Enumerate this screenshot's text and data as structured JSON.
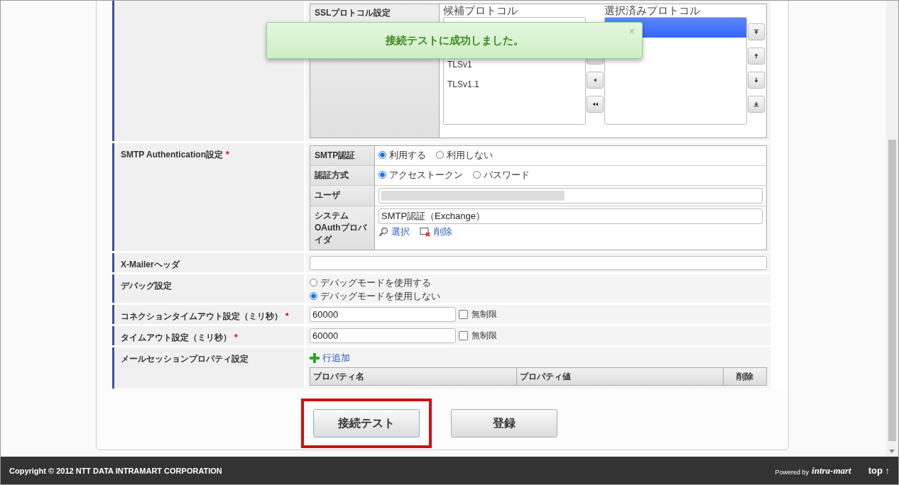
{
  "toast": {
    "message": "接続テストに成功しました。",
    "close": "×"
  },
  "ssl": {
    "label": "SSLプロトコル設定",
    "available_heading": "候補プロトコル",
    "selected_heading": "選択済みプロトコル",
    "available": [
      "TLSv1",
      "TLSv1.1"
    ],
    "chosen": [
      {
        "selected": true
      }
    ]
  },
  "smtp_auth": {
    "label": "SMTP Authentication設定",
    "required_mark": "*",
    "rows": [
      {
        "kind": "radio",
        "label": "SMTP認証",
        "options": [
          {
            "label": "利用する",
            "selected": true
          },
          {
            "label": "利用しない",
            "selected": false
          }
        ]
      },
      {
        "kind": "radio",
        "label": "認証方式",
        "options": [
          {
            "label": "アクセストークン",
            "selected": true
          },
          {
            "label": "パスワード",
            "selected": false
          }
        ]
      },
      {
        "kind": "redacted",
        "label": "ユーザ"
      },
      {
        "kind": "provider",
        "label": "システムOAuthプロバイダ",
        "value": "SMTP認証（Exchange）",
        "links": [
          "選択",
          "削除"
        ]
      }
    ]
  },
  "rows": [
    {
      "kind": "text",
      "label": "X-Mailerヘッダ",
      "value": ""
    },
    {
      "kind": "radio_list",
      "label": "デバッグ設定",
      "options": [
        {
          "label": "デバッグモードを使用する",
          "selected": false
        },
        {
          "label": "デバッグモードを使用しない",
          "selected": true
        }
      ]
    },
    {
      "kind": "number",
      "label": "コネクションタイムアウト設定（ミリ秒）",
      "required_mark": "*",
      "value": "60000",
      "checkbox": {
        "label": "無制限",
        "checked": false
      }
    },
    {
      "kind": "number",
      "label": "タイムアウト設定（ミリ秒）",
      "required_mark": "*",
      "value": "60000",
      "checkbox": {
        "label": "無制限",
        "checked": false
      }
    },
    {
      "kind": "properties",
      "label": "メールセッションプロパティ設定",
      "add_link": "行追加",
      "columns": [
        "プロパティ名",
        "プロパティ値",
        "削除"
      ]
    }
  ],
  "buttons": [
    {
      "label": "接続テスト",
      "highlighted": true
    },
    {
      "label": "登録",
      "highlighted": false
    }
  ],
  "footer": {
    "copyright": "Copyright © 2012 NTT DATA INTRAMART CORPORATION",
    "powered_by": "Powered by",
    "logo": "intra-mart",
    "top_link": "top ↑"
  }
}
